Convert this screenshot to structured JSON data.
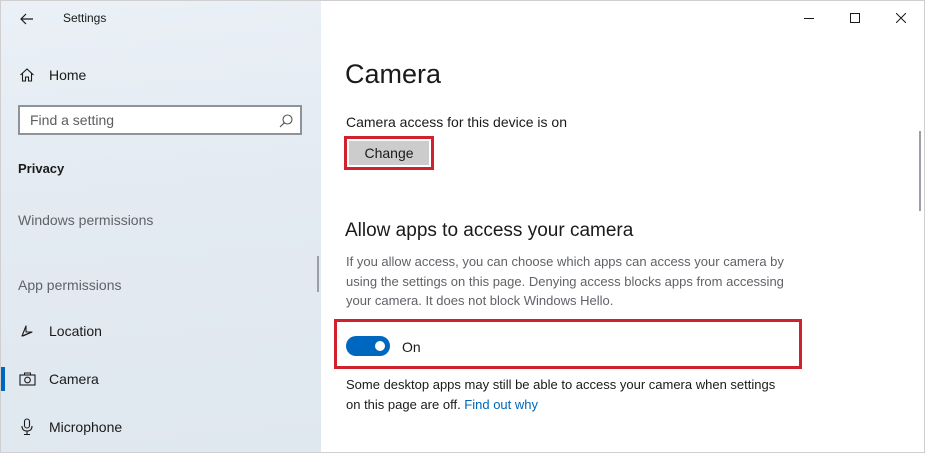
{
  "window": {
    "app_title": "Settings",
    "controls": [
      "minimize",
      "maximize",
      "close"
    ]
  },
  "sidebar": {
    "home_label": "Home",
    "search": {
      "placeholder": "Find a setting",
      "value": ""
    },
    "section_title": "Privacy",
    "group_windows": "Windows permissions",
    "group_apps": "App permissions",
    "items": [
      {
        "label": "Location",
        "icon": "location-icon",
        "selected": false
      },
      {
        "label": "Camera",
        "icon": "camera-icon",
        "selected": true
      },
      {
        "label": "Microphone",
        "icon": "microphone-icon",
        "selected": false
      }
    ]
  },
  "main": {
    "title": "Camera",
    "access_status": "Camera access for this device is on",
    "change_button": "Change",
    "section_title": "Allow apps to access your camera",
    "description": "If you allow access, you can choose which apps can access your camera by using the settings on this page. Denying access blocks apps from accessing your camera. It does not block Windows Hello.",
    "toggle": {
      "state": "on",
      "label": "On"
    },
    "note_text": "Some desktop apps may still be able to access your camera when settings on this page are off. ",
    "note_link": "Find out why"
  },
  "colors": {
    "accent": "#0067c0",
    "highlight_border": "#d1202e",
    "link": "#0067b8"
  }
}
